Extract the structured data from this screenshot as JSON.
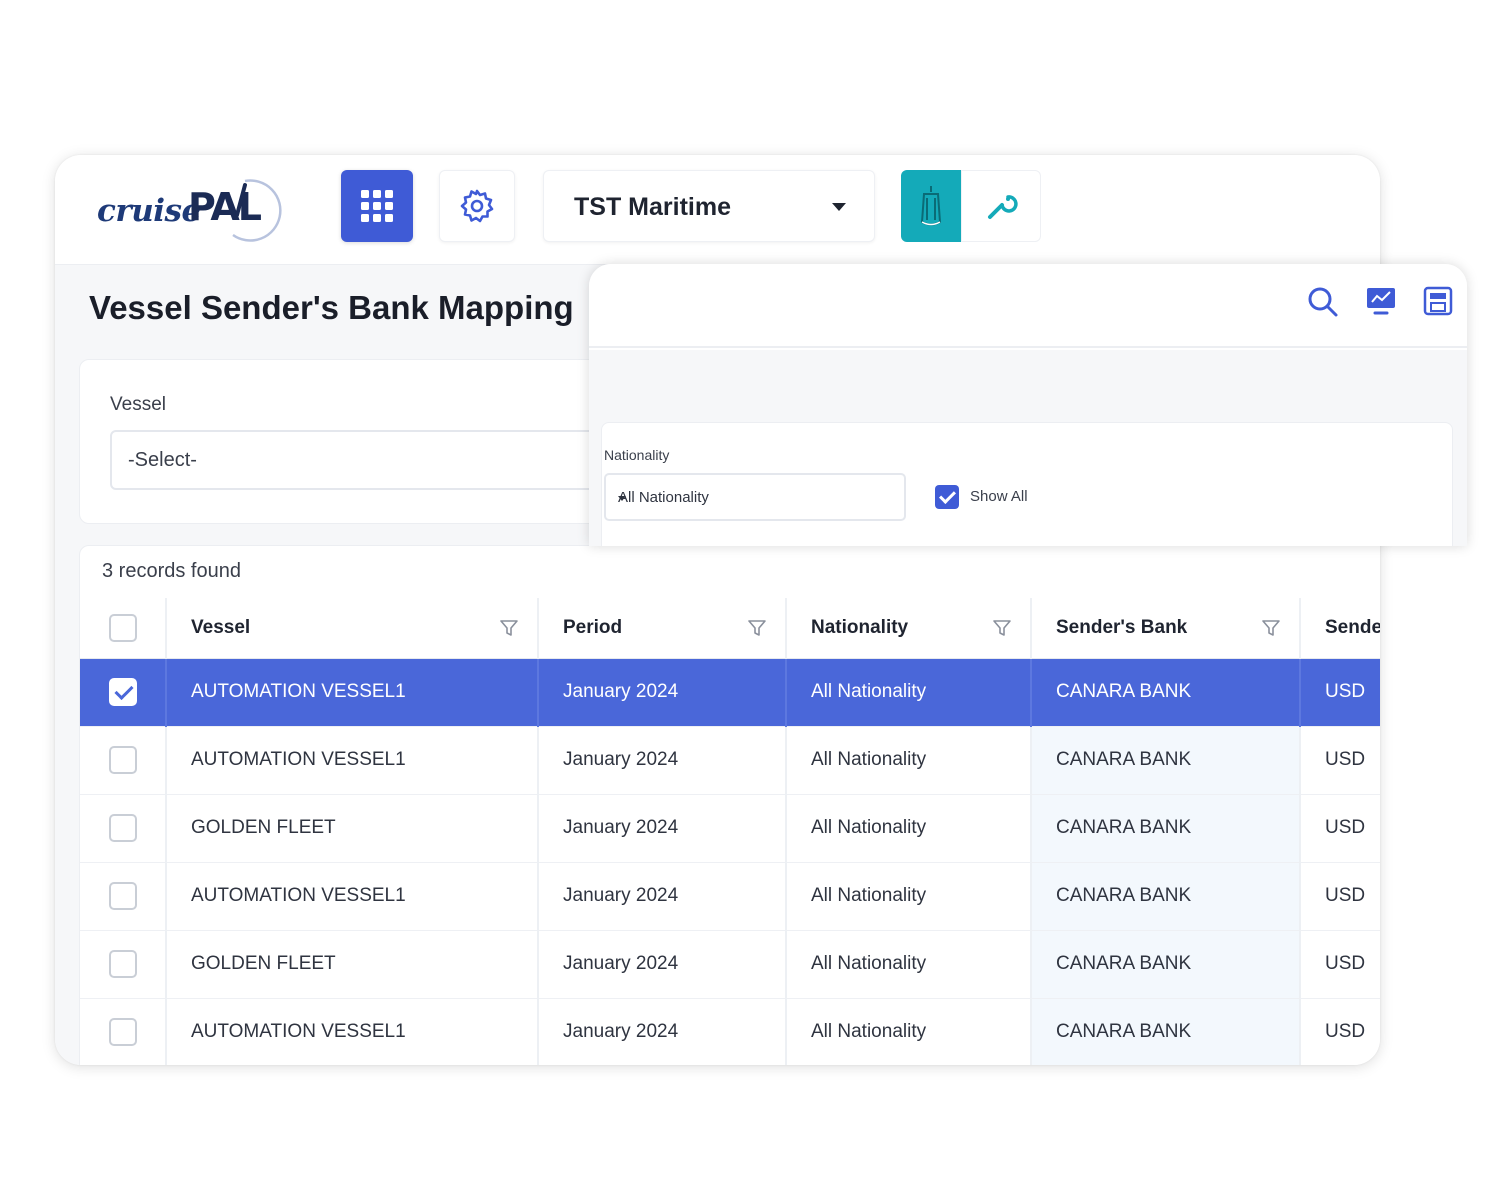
{
  "header": {
    "logo_left": "cruise",
    "logo_right": "PAL",
    "company": "TST Maritime"
  },
  "page": {
    "title": "Vessel Sender's Bank Mapping"
  },
  "filters": {
    "vessel_label": "Vessel",
    "vessel_value": "-Select-",
    "nationality_label": "Nationality",
    "nationality_value": "All Nationality",
    "show_all_label": "Show All",
    "show_all_checked": true
  },
  "results": {
    "count_text": "3 records found",
    "columns": [
      "Vessel",
      "Period",
      "Nationality",
      "Sender's Bank",
      "Sende"
    ],
    "rows": [
      {
        "vessel": "AUTOMATION VESSEL1",
        "period": "January 2024",
        "nationality": "All Nationality",
        "bank": "CANARA BANK",
        "currency": "USD",
        "selected": true
      },
      {
        "vessel": "AUTOMATION VESSEL1",
        "period": "January 2024",
        "nationality": "All Nationality",
        "bank": "CANARA BANK",
        "currency": "USD",
        "selected": false
      },
      {
        "vessel": "GOLDEN FLEET",
        "period": "January 2024",
        "nationality": "All Nationality",
        "bank": "CANARA BANK",
        "currency": "USD",
        "selected": false
      },
      {
        "vessel": "AUTOMATION VESSEL1",
        "period": "January 2024",
        "nationality": "All Nationality",
        "bank": "CANARA BANK",
        "currency": "USD",
        "selected": false
      },
      {
        "vessel": "GOLDEN FLEET",
        "period": "January 2024",
        "nationality": "All Nationality",
        "bank": "CANARA BANK",
        "currency": "USD",
        "selected": false
      },
      {
        "vessel": "AUTOMATION VESSEL1",
        "period": "January 2024",
        "nationality": "All Nationality",
        "bank": "CANARA BANK",
        "currency": "USD",
        "selected": false
      }
    ]
  },
  "icons": {
    "apps": "apps-grid-icon",
    "settings": "gear-icon",
    "ship": "ship-icon",
    "tools": "wrench-icon",
    "search": "search-icon",
    "report": "report-icon",
    "save": "save-icon",
    "filter": "filter-funnel-icon"
  },
  "colors": {
    "primary": "#3f5bd6",
    "selected_row": "#4a67d9",
    "ship_button": "#14aab9",
    "bank_column_tint": "#f3f8fd"
  }
}
